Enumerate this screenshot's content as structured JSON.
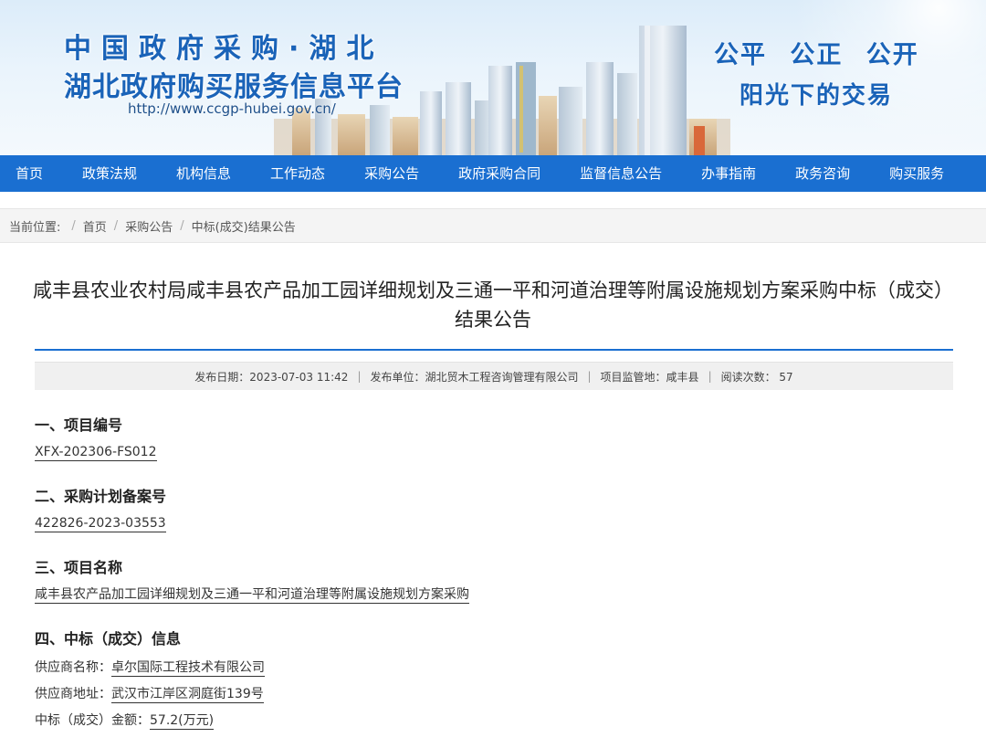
{
  "banner": {
    "title_line1": "中国政府采购·湖北",
    "title_line2": "湖北政府购买服务信息平台",
    "url": "http://www.ccgp-hubei.gov.cn/",
    "slogan_line1": "公平 公正 公开",
    "slogan_line2": "阳光下的交易"
  },
  "nav": {
    "items": [
      "首页",
      "政策法规",
      "机构信息",
      "工作动态",
      "采购公告",
      "政府采购合同",
      "监督信息公告",
      "办事指南",
      "政务咨询",
      "购买服务"
    ]
  },
  "breadcrumb": {
    "label": "当前位置:",
    "items": [
      "首页",
      "采购公告",
      "中标(成交)结果公告"
    ]
  },
  "article": {
    "title": "咸丰县农业农村局咸丰县农产品加工园详细规划及三通一平和河道治理等附属设施规划方案采购中标（成交）结果公告",
    "meta": {
      "date": "发布日期：2023-07-03 11:42",
      "publisher": "发布单位：湖北贸木工程咨询管理有限公司",
      "region": "项目监管地：咸丰县",
      "views": "阅读次数： 57"
    },
    "sections": [
      {
        "heading": "一、项目编号",
        "value": "XFX-202306-FS012"
      },
      {
        "heading": "二、采购计划备案号",
        "value": "422826-2023-03553"
      },
      {
        "heading": "三、项目名称",
        "value": "咸丰县农产品加工园详细规划及三通一平和河道治理等附属设施规划方案采购"
      }
    ],
    "award": {
      "heading": "四、中标（成交）信息",
      "supplier_name_label": "供应商名称：",
      "supplier_name": "卓尔国际工程技术有限公司",
      "supplier_address_label": "供应商地址：",
      "supplier_address": "武汉市江岸区洞庭街139号",
      "amount_label": "中标（成交）金额：",
      "amount": "57.2(万元)"
    }
  },
  "colors": {
    "brand_blue": "#1a6fd1",
    "banner_text": "#1a63b8"
  }
}
